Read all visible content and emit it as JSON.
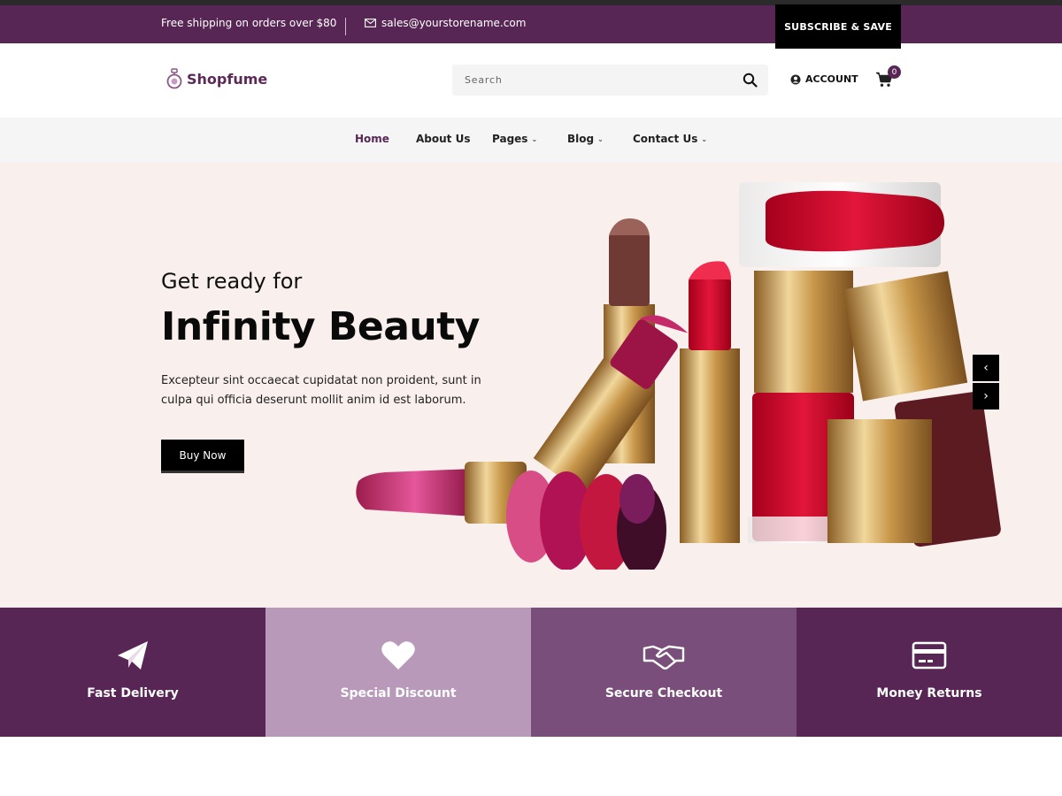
{
  "topbar": {
    "shipping_text": "Free shipping on orders over $80",
    "email": "sales@yourstorename.com",
    "email_icon": "envelope-icon",
    "subscribe_label": "SUBSCRIBE & SAVE"
  },
  "header": {
    "logo_text": "Shopfume",
    "logo_icon": "perfume-bottle-icon",
    "search_placeholder": "Search",
    "search_icon": "magnifier-icon",
    "account_label": "ACCOUNT",
    "account_icon": "user-circle-icon",
    "cart_icon": "shopping-cart-icon",
    "cart_count": "0"
  },
  "nav": {
    "items": [
      {
        "label": "Home",
        "active": true
      },
      {
        "label": "About Us"
      },
      {
        "label": "Pages",
        "dropdown": true
      },
      {
        "label": "Blog",
        "dropdown": true
      },
      {
        "label": "Contact Us",
        "dropdown": true
      }
    ],
    "dropdown_glyph": "⌄"
  },
  "hero": {
    "kicker": "Get ready for",
    "headline": "Infinity Beauty",
    "body": "Excepteur sint occaecat cupidatat non proident, sunt in culpa qui officia deserunt mollit anim id est laborum.",
    "cta_label": "Buy Now",
    "prev_glyph": "‹",
    "next_glyph": "›",
    "image_subject": "lipsticks-and-nail-polish-image"
  },
  "features": [
    {
      "label": "Fast Delivery",
      "icon": "paper-plane-icon",
      "color": "#572654"
    },
    {
      "label": "Special Discount",
      "icon": "heart-icon",
      "color": "#b899b9"
    },
    {
      "label": "Secure Checkout",
      "icon": "handshake-icon",
      "color": "#7a4e7b"
    },
    {
      "label": "Money Returns",
      "icon": "credit-card-icon",
      "color": "#572654"
    }
  ],
  "colors": {
    "brand": "#572654",
    "hero_bg": "#f9efec",
    "nav_bg": "#f5f5f5"
  }
}
